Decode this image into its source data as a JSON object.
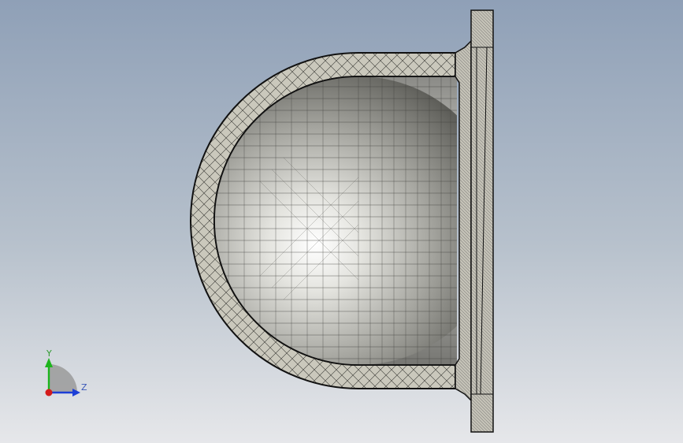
{
  "viewport": {
    "background_top": "#8fa0b7",
    "background_bottom": "#e6e7ea",
    "model": {
      "name": "hemispherical-dome-cap-with-flange",
      "display_mode": "shaded-with-edges",
      "surface_color": "#c9c7bd",
      "edge_color": "#1a1a1a"
    }
  },
  "triad": {
    "y_label": "Y",
    "z_label": "Z",
    "y_color": "#1db51d",
    "z_color": "#1d3fd6",
    "x_color": "#d41b1b"
  }
}
